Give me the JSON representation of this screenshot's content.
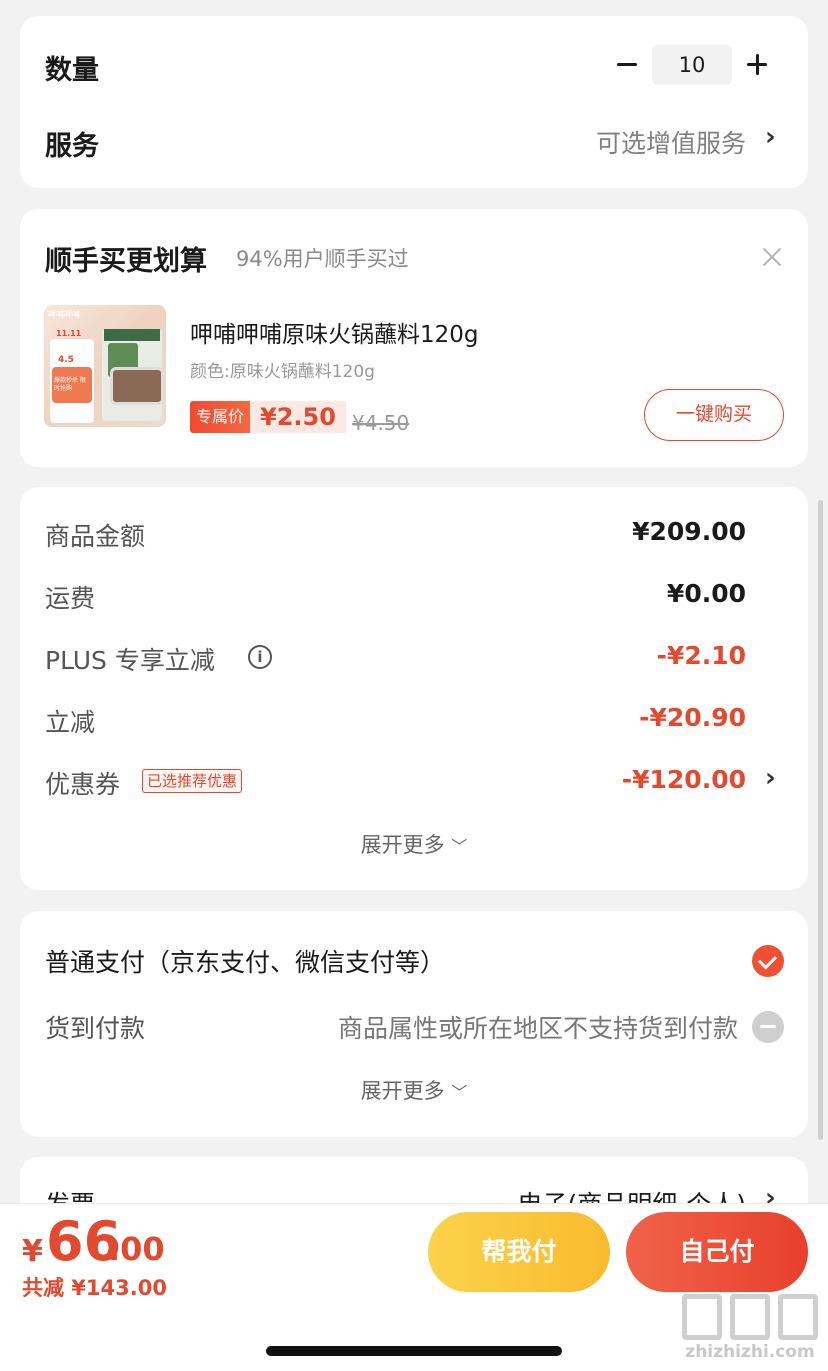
{
  "quantity": {
    "label": "数量",
    "value": "10"
  },
  "service": {
    "label": "服务",
    "value": "可选增值服务"
  },
  "addon": {
    "title": "顺手买更划算",
    "subtitle": "94%用户顺手买过",
    "product_name": "呷哺呷哺原味火锅蘸料120g",
    "spec": "颜色:原味火锅蘸料120g",
    "tag_label": "专属价",
    "price": "¥2.50",
    "original_price": "¥4.50",
    "buy_label": "一键购买",
    "thumb_brand": "呷哺呷哺",
    "thumb_promo": "11.11",
    "thumb_price": "4.5",
    "thumb_note": "爆款秒杀 限时抢购"
  },
  "cost": {
    "rows": [
      {
        "label": "商品金额",
        "value": "¥209.00"
      },
      {
        "label": "运费",
        "value": "¥0.00"
      },
      {
        "label": "PLUS 专享立减",
        "value": "-¥2.10"
      },
      {
        "label": "立减",
        "value": "-¥20.90"
      },
      {
        "label": "优惠券",
        "value": "-¥120.00"
      }
    ],
    "coupon_tag": "已选推荐优惠",
    "expand_label": "展开更多"
  },
  "payment": {
    "normal_label": "普通支付（京东支付、微信支付等）",
    "cod_label": "货到付款",
    "cod_note": "商品属性或所在地区不支持货到付款",
    "expand_label": "展开更多"
  },
  "invoice": {
    "label": "发票",
    "value": "电子(商品明细-个人)"
  },
  "bottom": {
    "yen": "¥",
    "total_int": "66",
    "total_dec": ".00",
    "saved": "共减 ¥143.00",
    "help_label": "帮我付",
    "self_label": "自己付"
  },
  "watermark": {
    "text": "zhizhizhi.com"
  },
  "colors": {
    "accent": "#e2492e",
    "help_button": "#f9bb2f",
    "pay_button": "#e8402c"
  }
}
